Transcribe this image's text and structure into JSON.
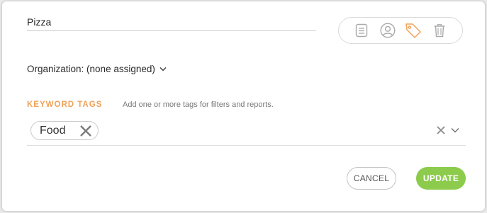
{
  "item": {
    "name_value": "Pizza"
  },
  "toolbar": {
    "icons": [
      "notes-icon",
      "user-icon",
      "tag-icon",
      "trash-icon"
    ],
    "active_icon": "tag-icon",
    "active_color": "#f0a35a",
    "inactive_color": "#a9a9a9"
  },
  "organization": {
    "label": "Organization: (none assigned)"
  },
  "keywords": {
    "label": "KEYWORD TAGS",
    "hint": "Add one or more tags for filters and reports.",
    "tags": [
      "Food"
    ]
  },
  "actions": {
    "cancel_label": "CANCEL",
    "update_label": "UPDATE",
    "update_color": "#8ccb4c"
  }
}
